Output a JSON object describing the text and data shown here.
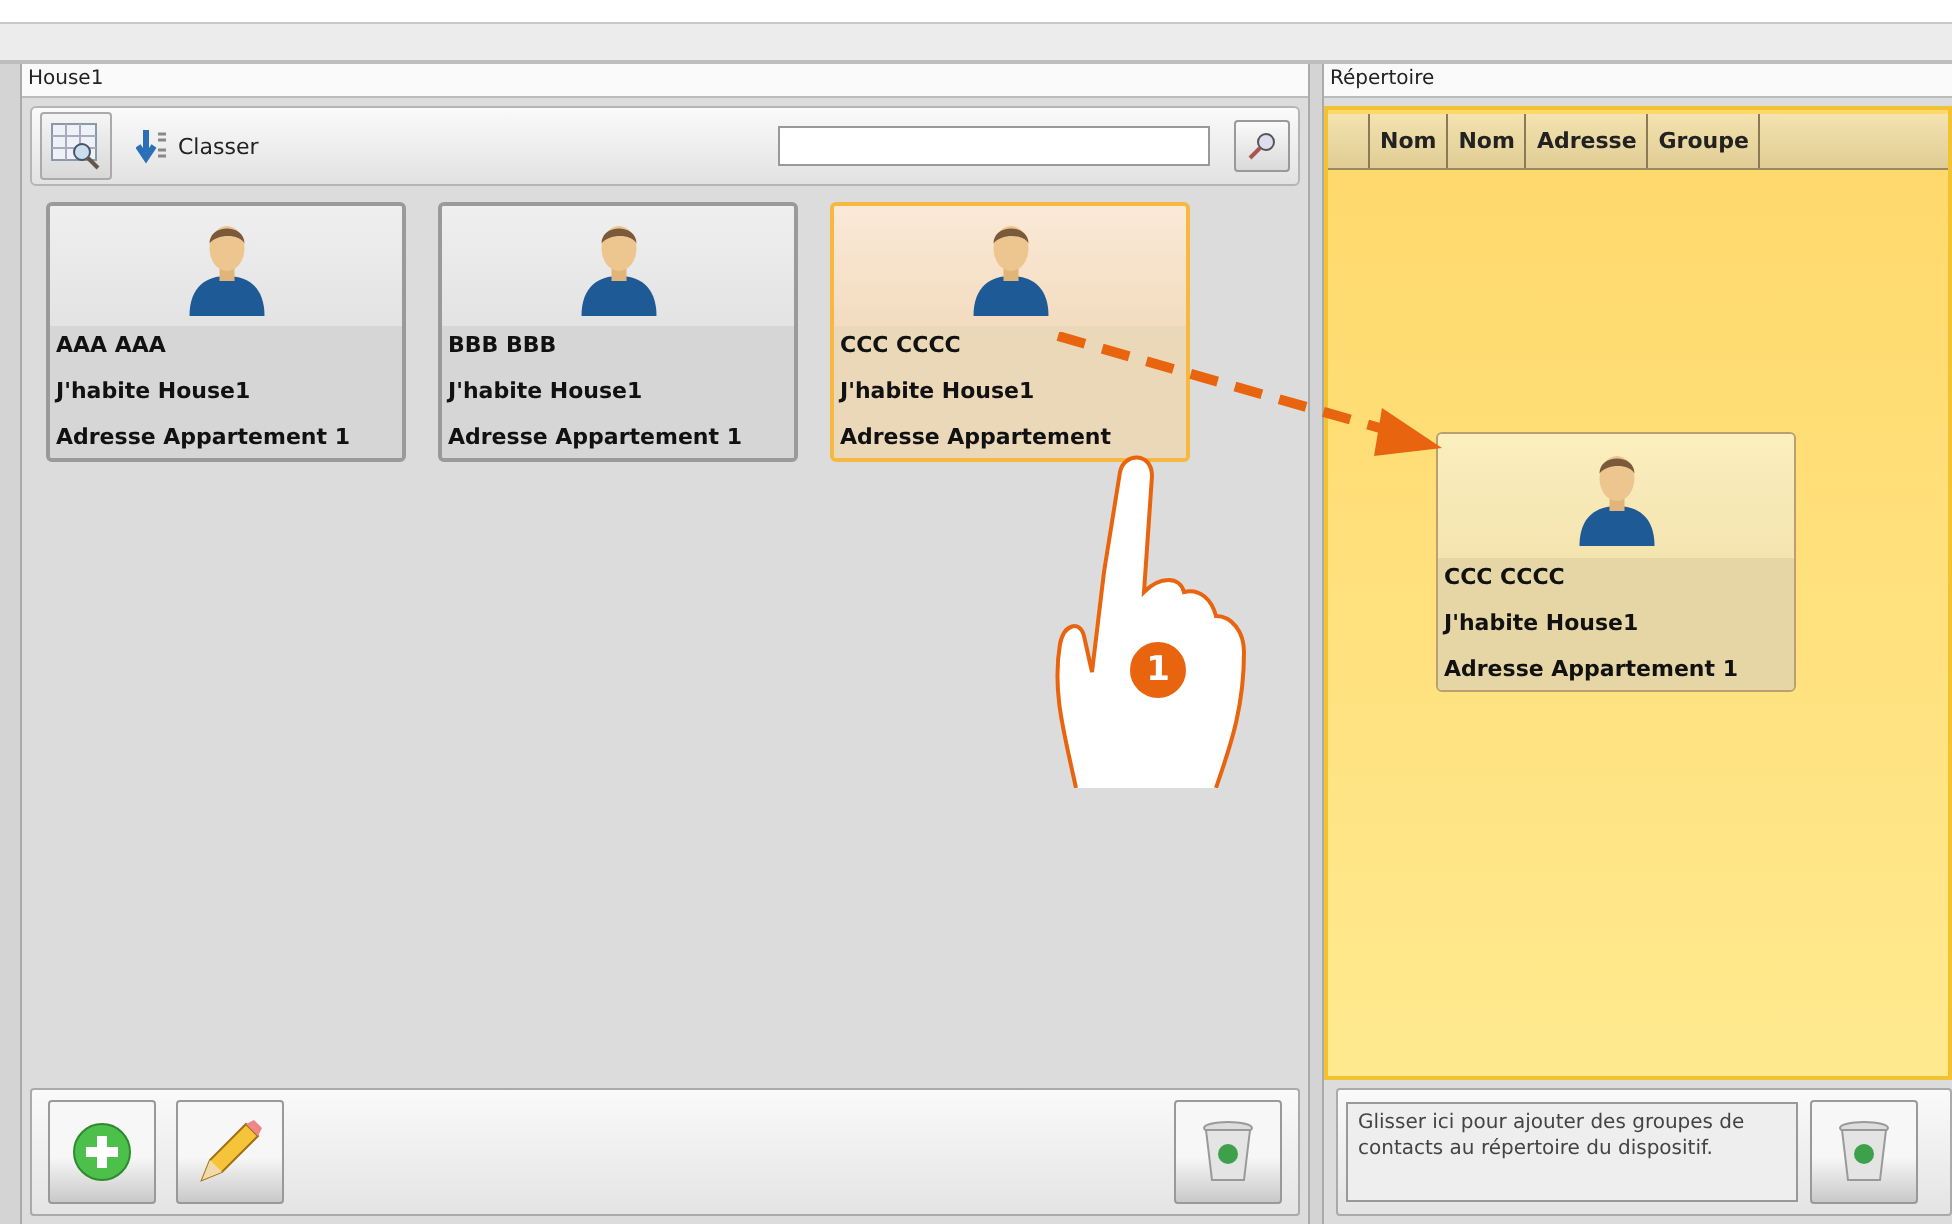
{
  "left_panel": {
    "title": "House1",
    "sort_label": "Classer",
    "contacts": [
      {
        "name": "AAA AAA",
        "line2": "J'habite  House1",
        "line3": "Adresse Appartement 1",
        "selected": false
      },
      {
        "name": "BBB BBB",
        "line2": "J'habite  House1",
        "line3": "Adresse Appartement 1",
        "selected": false
      },
      {
        "name": "CCC CCCC",
        "line2": "J'habite  House1",
        "line3": "Adresse Appartement",
        "selected": true
      }
    ]
  },
  "right_panel": {
    "title": "Répertoire",
    "columns": [
      "",
      "Nom",
      "Nom",
      "Adresse",
      "Groupe"
    ],
    "dragged_contact": {
      "name": "CCC CCCC",
      "line2": "J'habite  House1",
      "line3": "Adresse Appartement 1"
    },
    "drop_hint": "Glisser ici pour ajouter des groupes de contacts au répertoire du dispositif."
  },
  "step_badge": "1"
}
